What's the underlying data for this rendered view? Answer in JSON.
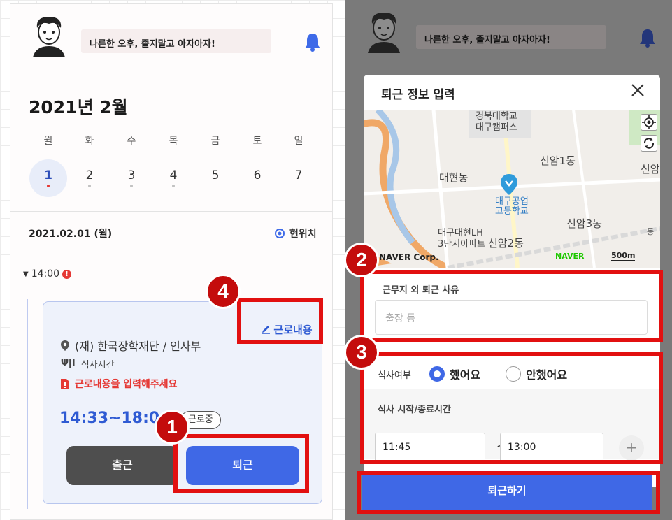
{
  "left": {
    "greeting": "나른한 오후, 졸지말고 아자아자!",
    "month_title": "2021년 2월",
    "week": [
      {
        "name": "월",
        "num": "1",
        "selected": true,
        "dot": "red"
      },
      {
        "name": "화",
        "num": "2",
        "dot": "grey"
      },
      {
        "name": "수",
        "num": "3",
        "dot": "grey"
      },
      {
        "name": "목",
        "num": "4",
        "dot": "grey"
      },
      {
        "name": "금",
        "num": "5"
      },
      {
        "name": "토",
        "num": "6"
      },
      {
        "name": "일",
        "num": "7"
      }
    ],
    "date_label": "2021.02.01 (월)",
    "current_location": "현위치",
    "time_header": "14:00",
    "card": {
      "work_content_link": "근로내용",
      "org": "(재) 한국장학재단 / 인사부",
      "meal": "식사시간",
      "warning": "근로내용을 입력해주세요",
      "time_range": "14:33~18:0",
      "status": "근로중",
      "btn_in": "출근",
      "btn_out": "퇴근"
    }
  },
  "right": {
    "greeting": "나른한 오후, 졸지말고 아자아자!",
    "modal_title": "퇴근 정보 입력",
    "map_labels": {
      "campus1": "경북대학교",
      "campus2": "대구캠퍼스",
      "daehyeon": "대현동",
      "sinam1": "신암1동",
      "sinam_cut": "신암",
      "school1": "대구공업",
      "school2": "고등학교",
      "sinam3": "신암3동",
      "lh1": "대구대현LH",
      "lh2": "3단지아파트",
      "sinam2": "신암2동",
      "naver_corp": "NAVER Corp.",
      "naver_logo": "NAVER",
      "scale": "500m",
      "dong_cut": "동"
    },
    "reason_label": "근무지 외 퇴근 사유",
    "reason_placeholder": "출장 등",
    "meal_label": "식사여부",
    "meal_yes": "했어요",
    "meal_no": "안했어요",
    "meal_time_label": "식사 시작/종료시간",
    "start_time": "11:45",
    "tilde": "~",
    "end_time": "13:00",
    "plus": "+",
    "submit": "퇴근하기"
  },
  "annotations": {
    "n1": "1",
    "n2": "2",
    "n3": "3",
    "n4": "4"
  },
  "colors": {
    "accent_blue": "#3f68e6",
    "annotation_red": "#e21010",
    "warning_red": "#e53935"
  }
}
